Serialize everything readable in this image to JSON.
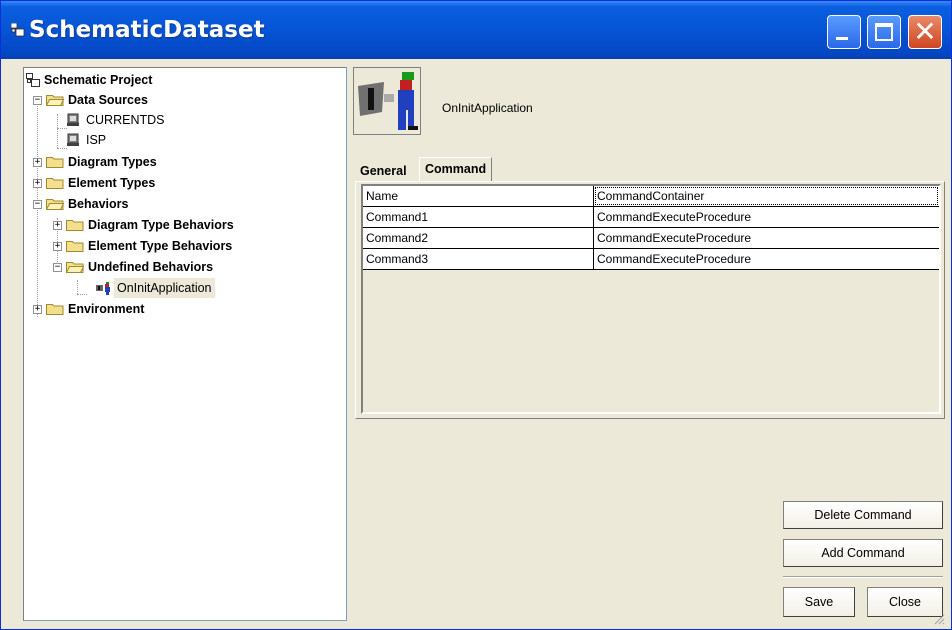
{
  "window": {
    "title": "SchematicDataset"
  },
  "tree": {
    "root": "Schematic Project",
    "data_sources": "Data Sources",
    "currentds": "CURRENTDS",
    "isp": "ISP",
    "diagram_types": "Diagram Types",
    "element_types": "Element Types",
    "behaviors": "Behaviors",
    "diagram_type_behaviors": "Diagram Type Behaviors",
    "element_type_behaviors": "Element Type Behaviors",
    "undefined_behaviors": "Undefined Behaviors",
    "oninit": "OnInitApplication",
    "environment": "Environment"
  },
  "detail": {
    "object_name": "OnInitApplication",
    "tabs": [
      "General",
      "Command"
    ],
    "rows": [
      {
        "name": "Name",
        "value": "CommandContainer"
      },
      {
        "name": "Command1",
        "value": "CommandExecuteProcedure"
      },
      {
        "name": "Command2",
        "value": "CommandExecuteProcedure"
      },
      {
        "name": "Command3",
        "value": "CommandExecuteProcedure"
      }
    ]
  },
  "buttons": {
    "delete_command": "Delete Command",
    "add_command": "Add Command",
    "save": "Save",
    "close": "Close"
  },
  "colors": {
    "titlebar": "#0654d6",
    "face": "#ece9d8",
    "close": "#d04620"
  }
}
